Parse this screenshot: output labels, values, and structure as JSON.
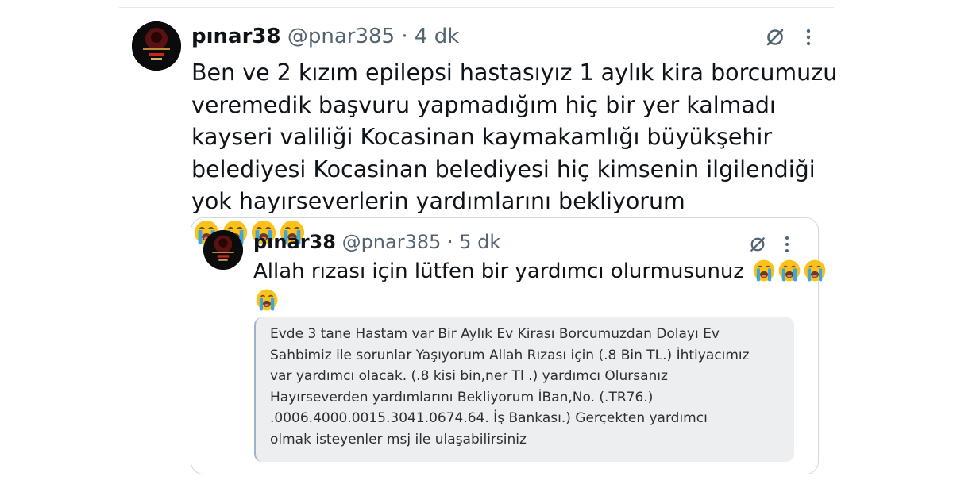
{
  "tweet": {
    "name": "pınar38",
    "handle": "@pnar385",
    "separator": " · ",
    "time": "4 dk",
    "lines": [
      "Ben ve 2 kızım epilepsi hastasıyız 1 aylık kira borcumuzu",
      "veremedik başvuru yapmadığım hiç bir yer kalmadı",
      "kayseri valiliği Kocasinan kaymakamlığı büyükşehir",
      "belediyesi Kocasinan belediyesi hiç kimsenin ilgilendiği",
      "yok hayırseverlerin yardımlarını bekliyorum"
    ],
    "emoji_count": 4
  },
  "quoted_tweet": {
    "name": "pınar38",
    "handle": "@pnar385",
    "separator": " · ",
    "time": "5 dk",
    "lines": [
      "Allah rızası için lütfen bir yardımcı olurmusunuz"
    ],
    "image_lines": [
      "Evde 3 tane Hastam var Bir Aylık Ev Kirası Borcumuzdan Dolayı Ev",
      "Sahbimiz ile sorunlar Yaşıyorum Allah Rızası için (.8 Bin TL.) İhtiyacımız",
      "var yardımcı olacak. (.8 kisi bin,ner Tl .) yardımcı Olursanız",
      "Hayırseverden yardımlarını Bekliyorum İBan,No. (.TR76.)",
      ".0006.4000.0015.3041.0674.64. İş Bankası.) Gerçekten yardımcı",
      "olmak isteyenler msj ile ulaşabilirsiniz"
    ]
  },
  "icons": {
    "grok": "grok-icon",
    "more": "more-options-icon",
    "emoji": "loudly-crying-face-emoji"
  },
  "colors": {
    "text": "#0f1419",
    "secondary": "#536471",
    "border": "#d4d9de",
    "image_bg": "#eceef0"
  }
}
